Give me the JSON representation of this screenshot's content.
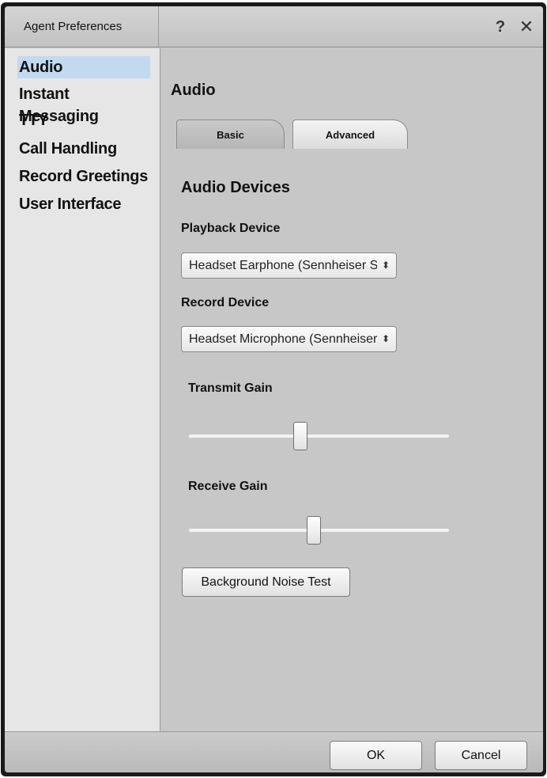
{
  "window": {
    "title": "Agent Preferences"
  },
  "titlebar": {
    "help_glyph": "?",
    "close_glyph": "✕"
  },
  "sidebar": {
    "items": [
      {
        "label": "Audio",
        "selected": true
      },
      {
        "label": "Instant Messaging",
        "selected": false
      },
      {
        "label": "TTY",
        "selected": false
      },
      {
        "label": "Call Handling",
        "selected": false
      },
      {
        "label": "Record Greetings",
        "selected": false
      },
      {
        "label": "User Interface",
        "selected": false
      }
    ]
  },
  "main": {
    "title": "Audio",
    "tabs": [
      {
        "label": "Basic",
        "active": false
      },
      {
        "label": "Advanced",
        "active": true
      }
    ],
    "section_title": "Audio Devices",
    "playback": {
      "label": "Playback Device",
      "value": "Headset Earphone (Sennheiser SC",
      "arrow_glyph": "⬍"
    },
    "record": {
      "label": "Record Device",
      "value": "Headset Microphone (Sennheiser",
      "arrow_glyph": "⬍"
    },
    "transmit_gain": {
      "label": "Transmit Gain",
      "level": 0.43
    },
    "receive_gain": {
      "label": "Receive Gain",
      "level": 0.48
    },
    "noise_test_button": "Background Noise Test"
  },
  "footer": {
    "ok_label": "OK",
    "cancel_label": "Cancel"
  },
  "colors": {
    "sidebar_selected": "#c3d9ef",
    "window_bg": "#c7c7c7",
    "sidebar_bg": "#e6e6e6"
  }
}
